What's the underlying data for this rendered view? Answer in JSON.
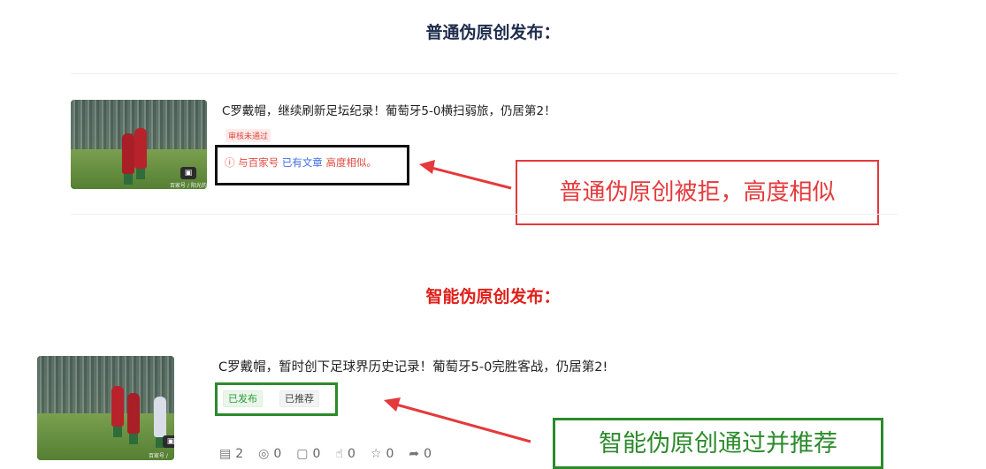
{
  "section1": {
    "heading": "普通伪原创发布：",
    "article": {
      "title": "C罗戴帽，继续刷新足坛纪录！葡萄牙5-0横扫弱旅，仍居第2！",
      "status_tag": "审核未通过",
      "reason": {
        "icon": "ⓘ",
        "part1": "与百家号",
        "link": "已有文章",
        "part2": "高度相似。"
      },
      "thumb_watermark": "百家号 / 阳光的阳光"
    },
    "callout": "普通伪原创被拒，高度相似"
  },
  "section2": {
    "heading": "智能伪原创发布：",
    "article": {
      "title": "C罗戴帽，暂时创下足球界历史记录！葡萄牙5-0完胜客战，仍居第2!",
      "chips": [
        "已发布",
        "已推荐"
      ],
      "stats": [
        {
          "icon": "document-icon",
          "glyph": "▤",
          "value": "2"
        },
        {
          "icon": "eye-icon",
          "glyph": "◎",
          "value": "0"
        },
        {
          "icon": "comment-icon",
          "glyph": "▢",
          "value": "0"
        },
        {
          "icon": "thumbs-up-icon",
          "glyph": "👍",
          "value": "0"
        },
        {
          "icon": "star-icon",
          "glyph": "☆",
          "value": "0"
        },
        {
          "icon": "share-icon",
          "glyph": "➦",
          "value": "0"
        }
      ],
      "thumb_watermark": "百家号 / 阳光的阳光"
    },
    "callout": "智能伪原创通过并推荐"
  },
  "colors": {
    "reject_red": "#e5393b",
    "pass_green": "#2b8a2b",
    "heading_navy": "#1f2d4d"
  }
}
